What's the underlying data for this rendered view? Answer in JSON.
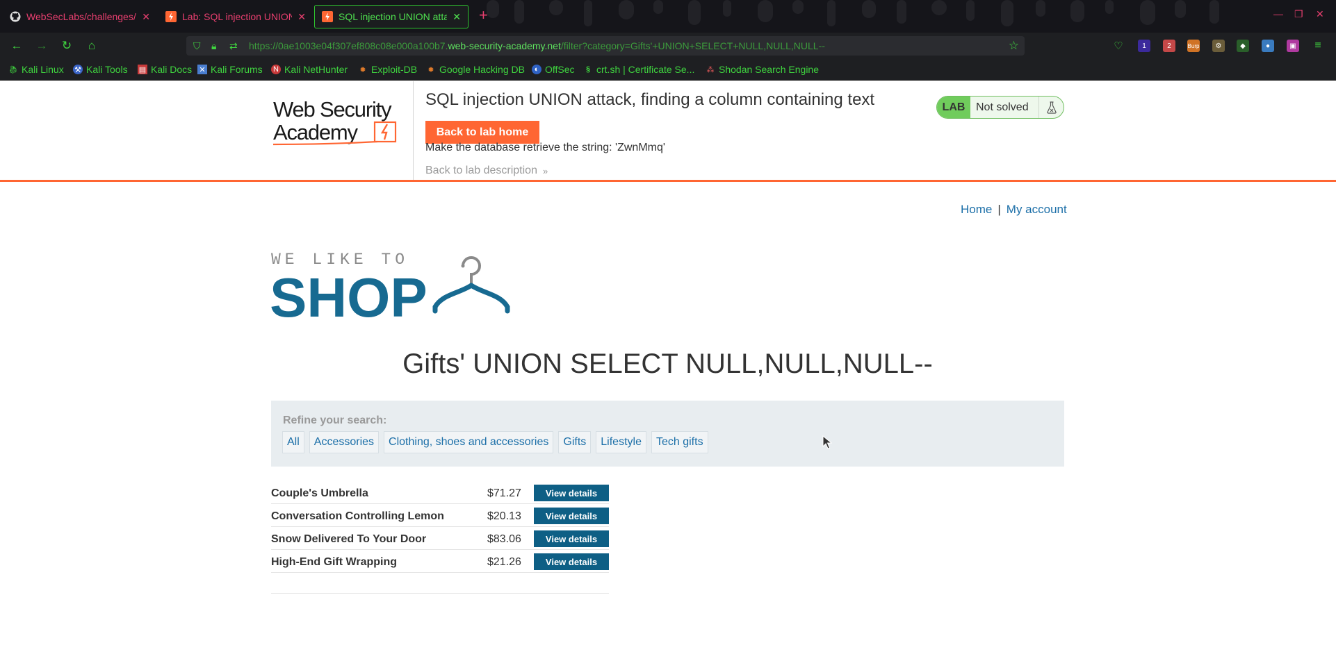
{
  "browser": {
    "tabs": [
      {
        "title": "WebSecLabs/challenges/sq",
        "icon": "github-icon",
        "active": false
      },
      {
        "title": "Lab: SQL injection UNION a",
        "icon": "wsa-lightning-icon",
        "active": false
      },
      {
        "title": "SQL injection UNION attack",
        "icon": "wsa-lightning-icon",
        "active": true
      }
    ],
    "new_tab_label": "+",
    "url_prefix": "https://0ae1003e04f307ef808c08e000a100b7.",
    "url_host": "web-security-academy.net",
    "url_path": "/filter?category=Gifts'+UNION+SELECT+NULL,NULL,NULL--",
    "extensions": [
      {
        "name": "ublock-icon",
        "badge": "1",
        "color": "#5b3fd4"
      },
      {
        "name": "multi-account-icon",
        "badge": "2",
        "color": "#d24a4a"
      },
      {
        "name": "burp-icon",
        "badge": "Burp",
        "color": "#e07b2a"
      }
    ],
    "bookmarks": [
      {
        "label": "Kali Linux",
        "icon": "kali-dragon-icon"
      },
      {
        "label": "Kali Tools",
        "icon": "kali-tools-icon"
      },
      {
        "label": "Kali Docs",
        "icon": "kali-docs-icon"
      },
      {
        "label": "Kali Forums",
        "icon": "kali-forums-icon"
      },
      {
        "label": "Kali NetHunter",
        "icon": "nethunter-icon"
      },
      {
        "label": "Exploit-DB",
        "icon": "exploit-db-icon"
      },
      {
        "label": "Google Hacking DB",
        "icon": "ghdb-icon"
      },
      {
        "label": "OffSec",
        "icon": "offsec-icon"
      },
      {
        "label": "crt.sh | Certificate Se...",
        "icon": "crtsh-icon"
      },
      {
        "label": "Shodan Search Engine",
        "icon": "shodan-icon"
      }
    ]
  },
  "lab": {
    "logo_line1": "Web Security",
    "logo_line2": "Academy",
    "title": "SQL injection UNION attack, finding a column containing text",
    "back_home_label": "Back to lab home",
    "description": "Make the database retrieve the string: 'ZwnMmq'",
    "back_description_label": "Back to lab description",
    "status_tag": "LAB",
    "status_text": "Not solved",
    "colors": {
      "accent": "#ff6633",
      "solved_green": "#70cc5c"
    }
  },
  "shop": {
    "nav": {
      "home": "Home",
      "separator": "|",
      "account": "My account"
    },
    "logo_top": "WE LIKE TO",
    "logo_main": "SHOP",
    "heading": "Gifts' UNION SELECT NULL,NULL,NULL--",
    "refine_label": "Refine your search:",
    "categories": [
      "All",
      "Accessories",
      "Clothing, shoes and accessories",
      "Gifts",
      "Lifestyle",
      "Tech gifts"
    ],
    "products": [
      {
        "name": "Couple's Umbrella",
        "price": "$71.27",
        "button": "View details"
      },
      {
        "name": "Conversation Controlling Lemon",
        "price": "$20.13",
        "button": "View details"
      },
      {
        "name": "Snow Delivered To Your Door",
        "price": "$83.06",
        "button": "View details"
      },
      {
        "name": "High-End Gift Wrapping",
        "price": "$21.26",
        "button": "View details"
      }
    ],
    "colors": {
      "link": "#1c6fa8",
      "button": "#0e5f85",
      "logo_blue": "#176a91"
    }
  }
}
